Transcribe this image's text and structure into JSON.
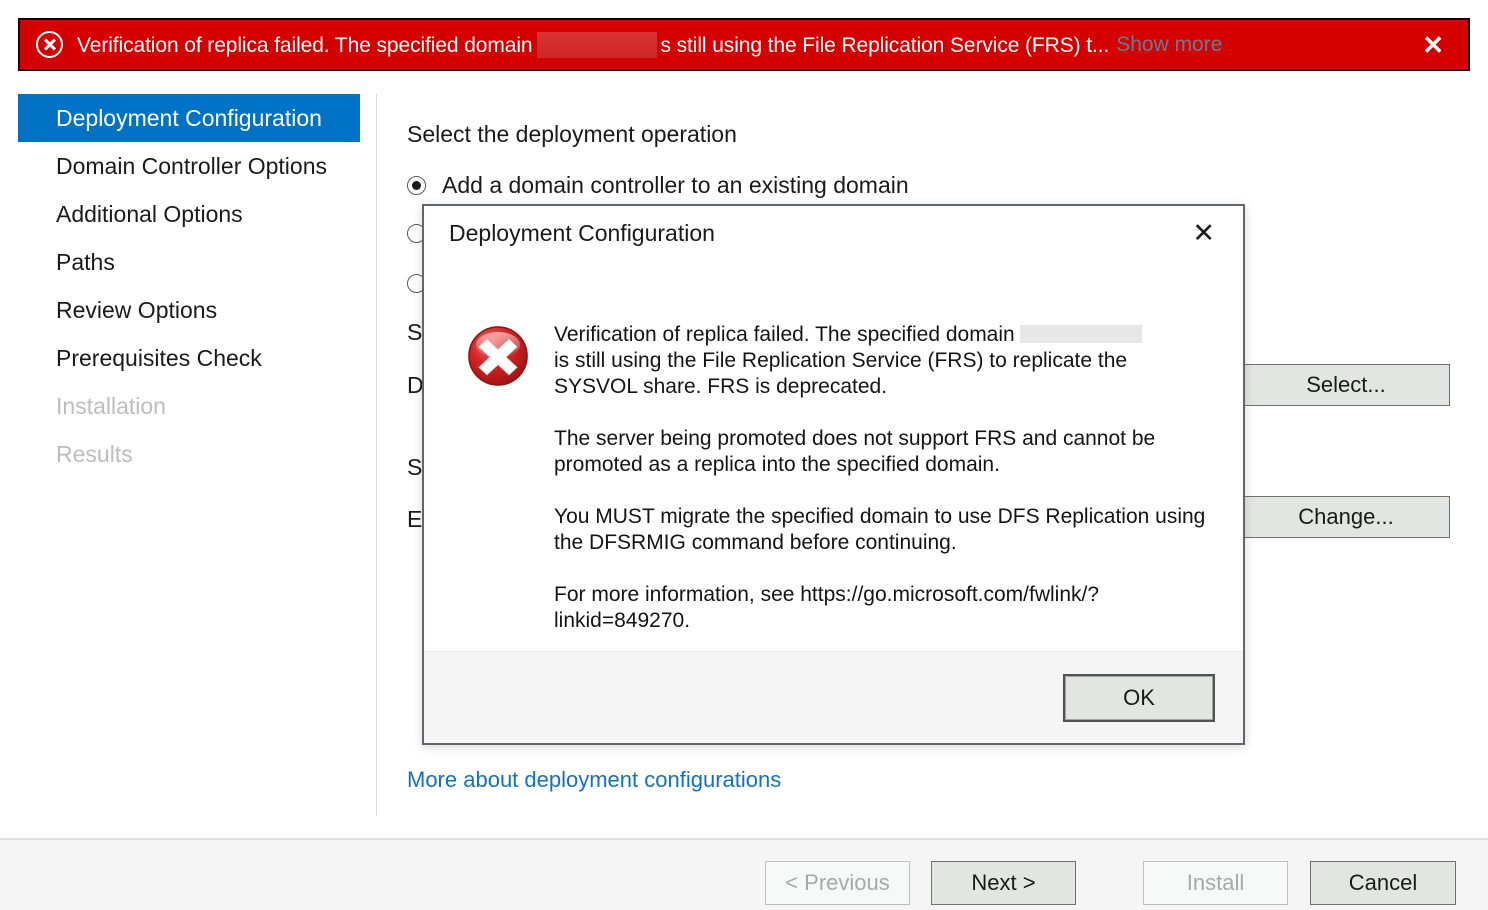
{
  "banner": {
    "icon": "error-circle-x-icon",
    "text_before": "Verification of replica failed. The specified domain",
    "text_after": "s still using the File Replication Service (FRS) t...",
    "show_more": "Show more",
    "close": "✕",
    "background_color": "#d40000",
    "text_color": "#ffffff",
    "link_color": "#6a7a95"
  },
  "sidebar": {
    "items": [
      {
        "label": "Deployment Configuration",
        "state": "selected"
      },
      {
        "label": "Domain Controller Options",
        "state": "enabled"
      },
      {
        "label": "Additional Options",
        "state": "enabled"
      },
      {
        "label": "Paths",
        "state": "enabled"
      },
      {
        "label": "Review Options",
        "state": "enabled"
      },
      {
        "label": "Prerequisites Check",
        "state": "enabled"
      },
      {
        "label": "Installation",
        "state": "disabled"
      },
      {
        "label": "Results",
        "state": "disabled"
      }
    ],
    "selected_color": "#0072c6"
  },
  "main": {
    "heading": "Select the deployment operation",
    "radios": [
      {
        "label": "Add a domain controller to an existing domain",
        "checked": true
      },
      {
        "label": "",
        "checked": false
      },
      {
        "label": "",
        "checked": false
      }
    ],
    "field_labels": [
      "S",
      "D",
      "S",
      "E"
    ],
    "select_button": "Select...",
    "change_button": "Change...",
    "more_link": "More about deployment configurations",
    "link_color": "#1570c0"
  },
  "dialog": {
    "title": "Deployment Configuration",
    "close": "✕",
    "icon": "error-circle-x-icon",
    "paragraphs": [
      {
        "before": "Verification of replica failed. The specified domain",
        "after": "is still using the File Replication Service (FRS) to replicate the SYSVOL share. FRS is deprecated.",
        "has_redaction": true
      },
      {
        "before": "The server being promoted does not support FRS and cannot be promoted as a replica into the specified domain.",
        "after": "",
        "has_redaction": false
      },
      {
        "before": "You MUST migrate the specified domain to use DFS Replication using the DFSRMIG command before continuing.",
        "after": "",
        "has_redaction": false
      },
      {
        "before": "For more information, see https://go.microsoft.com/fwlink/?linkid=849270.",
        "after": "",
        "has_redaction": false
      }
    ],
    "ok_button": "OK"
  },
  "footer": {
    "previous": "< Previous",
    "next": "Next >",
    "install": "Install",
    "cancel": "Cancel"
  }
}
